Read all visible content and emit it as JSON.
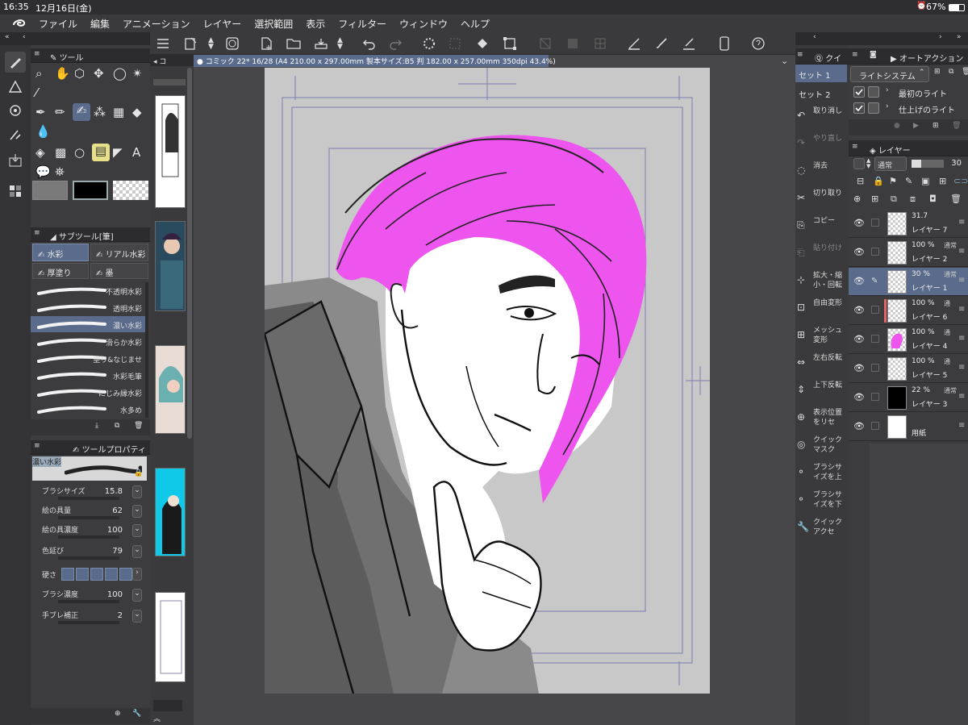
{
  "status": {
    "time": "16:35",
    "date": "12月16日(金)",
    "battery": "67%"
  },
  "menu": [
    "ファイル",
    "編集",
    "アニメーション",
    "レイヤー",
    "選択範囲",
    "表示",
    "フィルター",
    "ウィンドウ",
    "ヘルプ"
  ],
  "canvas_tab": {
    "title": "コミック 22* 16/28 (A4 210.00 x 297.00mm 製本サイズ:B5 判 182.00 x 257.00mm 350dpi 43.4%)"
  },
  "tool_panel": {
    "title": "ツール"
  },
  "subtool_panel": {
    "title": "サブツール[筆]",
    "groups": [
      "水彩",
      "リアル水彩",
      "厚塗り",
      "墨"
    ],
    "brushes": [
      "不透明水彩",
      "透明水彩",
      "濃い水彩",
      "滑らか水彩",
      "塗り&なじませ",
      "水彩毛筆",
      "にじみ縁水彩",
      "水多め"
    ],
    "selected_brush": "濃い水彩"
  },
  "tool_property": {
    "title": "ツールプロパティ",
    "brush_name": "濃い水彩",
    "props": [
      {
        "label": "ブラシサイズ",
        "value": "15.8"
      },
      {
        "label": "絵の具量",
        "value": "62"
      },
      {
        "label": "絵の具濃度",
        "value": "100"
      },
      {
        "label": "色延び",
        "value": "79"
      },
      {
        "label": "硬さ",
        "value": ""
      },
      {
        "label": "ブラシ濃度",
        "value": "100"
      },
      {
        "label": "手ブレ補正",
        "value": "2"
      }
    ]
  },
  "quick_access": {
    "title": "クイ",
    "sets": [
      "セット 1",
      "セット 2"
    ],
    "items": [
      "取り消し",
      "やり直し",
      "消去",
      "切り取り",
      "コピー",
      "貼り付け",
      "拡大・縮小・回転",
      "自由変形",
      "メッシュ変形",
      "左右反転",
      "上下反転",
      "表示位置をリセ",
      "クイックマスク",
      "ブラシサイズを上",
      "ブラシサイズを下",
      "クイックアクセ"
    ]
  },
  "auto_action": {
    "title": "オートアクション",
    "set_name": "ライトシステム",
    "actions": [
      "最初のライト",
      "仕上げのライト"
    ]
  },
  "layer_panel": {
    "title": "レイヤー",
    "blend_mode": "通常",
    "opacity": "30",
    "layers": [
      {
        "opacity": "31.7",
        "mode": "",
        "name": "レイヤー 7"
      },
      {
        "opacity": "100 %",
        "mode": "通常",
        "name": "レイヤー 2"
      },
      {
        "opacity": "30 %",
        "mode": "通常",
        "name": "レイヤー 1"
      },
      {
        "opacity": "100 %",
        "mode": "通",
        "name": "レイヤー 6"
      },
      {
        "opacity": "100 %",
        "mode": "通",
        "name": "レイヤー 4"
      },
      {
        "opacity": "100 %",
        "mode": "通",
        "name": "レイヤー 5"
      },
      {
        "opacity": "22 %",
        "mode": "通常",
        "name": "レイヤー 3"
      },
      {
        "opacity": "",
        "mode": "",
        "name": "用紙"
      }
    ]
  },
  "colors": {
    "accent": "#5a6b8c",
    "hair": "#ee55ee",
    "canvas_bg": "#c8c8c8"
  }
}
